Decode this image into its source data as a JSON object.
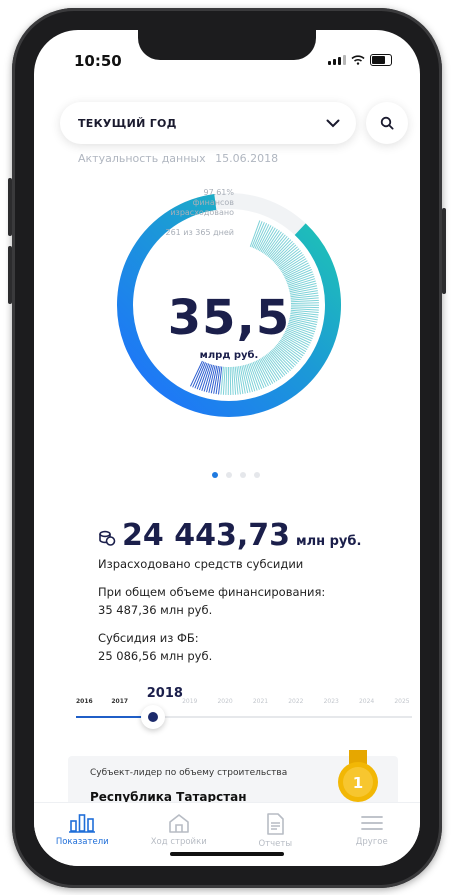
{
  "status": {
    "time": "10:50"
  },
  "header": {
    "period_label": "ТЕКУЩИЙ ГОД",
    "actuality_label": "Актуальность данных",
    "actuality_date": "15.06.2018"
  },
  "summary": {
    "value": "35,5",
    "unit": "млрд руб.",
    "spent_percent": "97.61%",
    "spent_caption_1": "финансов",
    "spent_caption_2": "израсходовано",
    "days": "261 из 365 дней",
    "spent_fraction": 0.9761,
    "days_fraction": 0.715
  },
  "pager": {
    "count": 4,
    "active": 0
  },
  "stats": {
    "spent_value": "24 443,73",
    "spent_unit": "млн руб.",
    "spent_label": "Израсходовано средств субсидии",
    "total_label": "При общем объеме финансирования:",
    "total_value": "35 487,36 млн руб.",
    "fb_label": "Субсидия из ФБ:",
    "fb_value": "25 086,56 млн руб."
  },
  "timeline": {
    "years": [
      "2016",
      "2017",
      "2018",
      "2019",
      "2020",
      "2021",
      "2022",
      "2023",
      "2024",
      "2025"
    ],
    "selected": "2018"
  },
  "leader": {
    "caption": "Субъект-лидер по объему строительства",
    "region": "Республика Татарстан",
    "medal_text": "1"
  },
  "tabs": [
    {
      "label": "Показатели",
      "icon": "bar-chart-icon"
    },
    {
      "label": "Ход стройки",
      "icon": "house-icon"
    },
    {
      "label": "Отчеты",
      "icon": "document-icon"
    },
    {
      "label": "Другое",
      "icon": "menu-icon"
    }
  ],
  "colors": {
    "accent": "#1f7ae0",
    "teal": "#22c6b5",
    "dark_navy": "#1b1f4b",
    "medal": "#f2b705"
  }
}
